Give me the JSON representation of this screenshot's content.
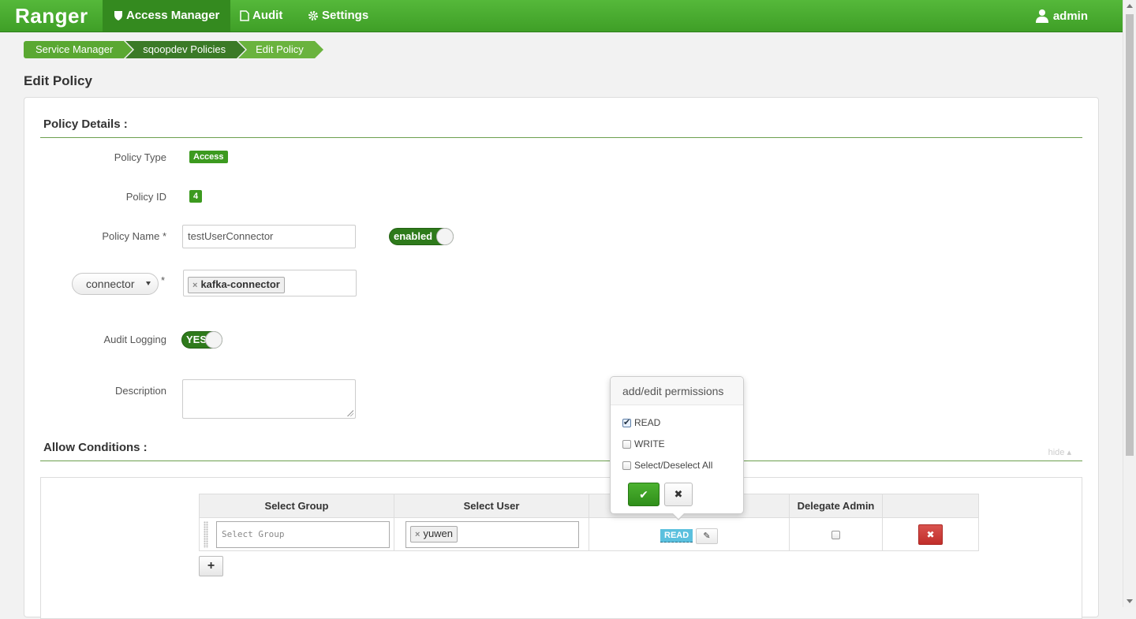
{
  "nav": {
    "brand": "Ranger",
    "items": [
      {
        "label": "Access Manager",
        "icon": "shield-icon"
      },
      {
        "label": "Audit",
        "icon": "file-icon"
      },
      {
        "label": "Settings",
        "icon": "gear-icon"
      }
    ],
    "user": "admin"
  },
  "breadcrumb": [
    "Service Manager",
    "sqoopdev Policies",
    "Edit Policy"
  ],
  "page_title": "Edit Policy",
  "policy_details": {
    "section_title": "Policy Details :",
    "policy_type_label": "Policy Type",
    "policy_type_value": "Access",
    "policy_id_label": "Policy ID",
    "policy_id_value": "4",
    "policy_name_label": "Policy Name *",
    "policy_name_value": "testUserConnector",
    "enabled_toggle": "enabled",
    "resource_type": "connector",
    "resource_required": "*",
    "resource_tag": "kafka-connector",
    "audit_logging_label": "Audit Logging",
    "audit_logging_toggle": "YES",
    "description_label": "Description"
  },
  "allow_conditions": {
    "section_title": "Allow Conditions :",
    "hide_link": "hide",
    "columns": [
      "Select Group",
      "Select User",
      "",
      "Delegate Admin",
      ""
    ],
    "group_placeholder": "Select Group",
    "user_tag": "yuwen",
    "permission_label": "READ"
  },
  "popover": {
    "title": "add/edit permissions",
    "options": [
      {
        "label": "READ",
        "checked": true
      },
      {
        "label": "WRITE",
        "checked": false
      },
      {
        "label": "Select/Deselect All",
        "checked": false
      }
    ]
  },
  "colors": {
    "navbar": "#4aae31",
    "accent_green": "#3c9a1f",
    "info_blue": "#5bc0de",
    "danger_red": "#d9534f"
  }
}
